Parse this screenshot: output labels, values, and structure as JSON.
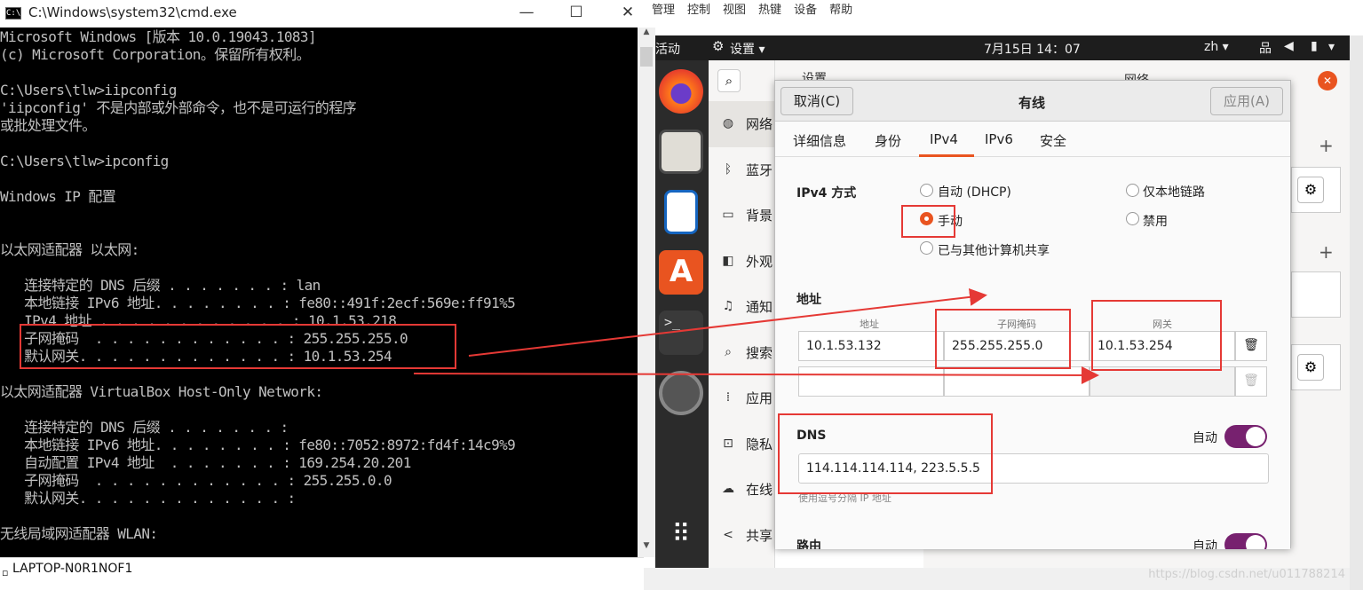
{
  "cmd": {
    "title": "C:\\Windows\\system32\\cmd.exe",
    "icon_label": "C:\\.",
    "minimize": "—",
    "maximize": "☐",
    "close": "✕",
    "lines": [
      "Microsoft Windows [版本 10.0.19043.1083]",
      "(c) Microsoft Corporation。保留所有权利。",
      "",
      "C:\\Users\\tlw>iipconfig",
      "'iipconfig' 不是内部或外部命令，也不是可运行的程序",
      "或批处理文件。",
      "",
      "C:\\Users\\tlw>ipconfig",
      "",
      "Windows IP 配置",
      "",
      "",
      "以太网适配器 以太网:",
      "",
      "   连接特定的 DNS 后缀 . . . . . . . : lan",
      "   本地链接 IPv6 地址. . . . . . . . : fe80::491f:2ecf:569e:ff91%5",
      "   IPv4 地址 . . . . . . . . . . . . : 10.1.53.218",
      "   子网掩码  . . . . . . . . . . . . : 255.255.255.0",
      "   默认网关. . . . . . . . . . . . . : 10.1.53.254",
      "",
      "以太网适配器 VirtualBox Host-Only Network:",
      "",
      "   连接特定的 DNS 后缀 . . . . . . . :",
      "   本地链接 IPv6 地址. . . . . . . . : fe80::7052:8972:fd4f:14c9%9",
      "   自动配置 IPv4 地址  . . . . . . . : 169.254.20.201",
      "   子网掩码  . . . . . . . . . . . . : 255.255.0.0",
      "   默认网关. . . . . . . . . . . . . :",
      "",
      "无线局域网适配器 WLAN:"
    ]
  },
  "taskbar_item": "LAPTOP-N0R1NOF1",
  "vm_menu": [
    "管理",
    "控制",
    "视图",
    "热键",
    "设备",
    "帮助"
  ],
  "topbar": {
    "activities": "活动",
    "app_menu": "设置 ▾",
    "clock": "7月15日 14：07",
    "lang": "zh ▾"
  },
  "settings_header": {
    "title": "设置",
    "right_title": "网络"
  },
  "sidebar": [
    {
      "icon": "wifi-icon",
      "glyph": "◍",
      "label": "网络"
    },
    {
      "icon": "bluetooth-icon",
      "glyph": "ᛒ",
      "label": "蓝牙"
    },
    {
      "icon": "display-icon",
      "glyph": "▭",
      "label": "背景"
    },
    {
      "icon": "appearance-icon",
      "glyph": "◧",
      "label": "外观"
    },
    {
      "icon": "bell-icon",
      "glyph": "♫",
      "label": "通知"
    },
    {
      "icon": "search-icon",
      "glyph": "⌕",
      "label": "搜索"
    },
    {
      "icon": "apps-icon",
      "glyph": "⁞",
      "label": "应用"
    },
    {
      "icon": "lock-icon",
      "glyph": "⊡",
      "label": "隐私"
    },
    {
      "icon": "cloud-icon",
      "glyph": "☁",
      "label": "在线"
    },
    {
      "icon": "share-icon",
      "glyph": "<",
      "label": "共享"
    }
  ],
  "dialog": {
    "cancel": "取消(C)",
    "title": "有线",
    "apply": "应用(A)",
    "tabs": [
      "详细信息",
      "身份",
      "IPv4",
      "IPv6",
      "安全"
    ],
    "active_tab": "IPv4",
    "ipv4_method_label": "IPv4 方式",
    "methods": {
      "auto": "自动 (DHCP)",
      "manual": "手动",
      "shared": "已与其他计算机共享",
      "link_local": "仅本地链路",
      "disabled": "禁用"
    },
    "selected_method": "手动",
    "address_label": "地址",
    "col_address": "地址",
    "col_netmask": "子网掩码",
    "col_gateway": "网关",
    "row1": {
      "address": "10.1.53.132",
      "netmask": "255.255.255.0",
      "gateway": "10.1.53.254"
    },
    "dns_label": "DNS",
    "dns_auto_label": "自动",
    "dns_auto_on": true,
    "dns_value": "114.114.114.114, 223.5.5.5",
    "dns_hint": "使用逗号分隔 IP 地址",
    "route_label": "路由",
    "route_auto_label": "自动"
  },
  "watermark": "https://blog.csdn.net/u011788214",
  "colors": {
    "accent": "#e95420",
    "toggle": "#77216f",
    "annotation": "#e53935"
  }
}
